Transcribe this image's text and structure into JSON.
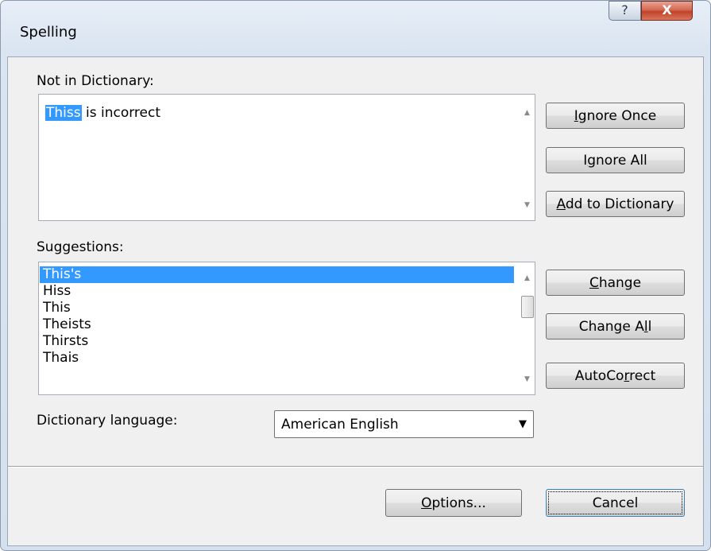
{
  "window": {
    "title": "Spelling",
    "help_label": "?",
    "close_label": "X"
  },
  "not_in_dictionary": {
    "label": "Not in Dictionary:",
    "highlighted_word": "Thiss",
    "rest_text": " is incorrect"
  },
  "suggestions": {
    "label": "Suggestions:",
    "items": [
      "This's",
      "Hiss",
      "This",
      "Theists",
      "Thirsts",
      "Thais"
    ],
    "selected_index": 0
  },
  "buttons": {
    "ignore_once": {
      "mnemonic": "I",
      "rest": "gnore Once"
    },
    "ignore_all": {
      "pre": "I",
      "mnemonic": "g",
      "rest": "nore All"
    },
    "add_to_dictionary": {
      "mnemonic": "A",
      "rest": "dd to Dictionary"
    },
    "change": {
      "mnemonic": "C",
      "rest": "hange"
    },
    "change_all": {
      "pre": "Change A",
      "mnemonic": "l",
      "rest": "l"
    },
    "autocorrect": {
      "pre": "AutoCo",
      "mnemonic": "r",
      "rest": "rect"
    },
    "options": {
      "mnemonic": "O",
      "rest": "ptions..."
    },
    "cancel": "Cancel"
  },
  "dictionary_language": {
    "label": "Dictionary language:",
    "selected": "American English"
  },
  "icons": {
    "scroll_up": "▲",
    "scroll_down": "▼",
    "dropdown": "▼"
  }
}
